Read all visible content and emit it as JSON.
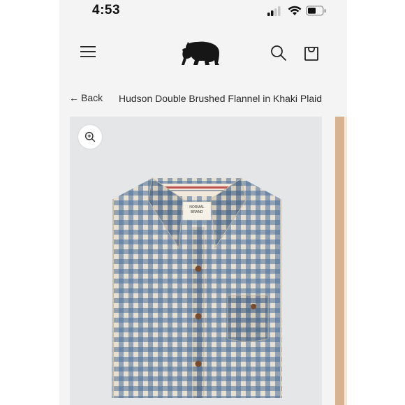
{
  "status_bar": {
    "time": "4:53",
    "icons": [
      "signal-icon",
      "wifi-icon",
      "battery-icon"
    ]
  },
  "header": {
    "icons": [
      "menu-icon",
      "bear-logo-icon",
      "search-icon",
      "shopping-bag-icon"
    ]
  },
  "breadcrumb": {
    "back_label": "Back",
    "product_title": "Hudson Double Brushed Flannel in Khaki Plaid"
  },
  "gallery": {
    "zoom_icon": "zoom-in-icon",
    "label_text": [
      "NORMAL",
      "BRAND"
    ]
  },
  "colors": {
    "page_background": "#f4f4f4",
    "gallery_background": "#e5e6e8",
    "plaid_blue": "#4c6f9a",
    "plaid_cream": "#e8dfcf",
    "button_brown": "#7a4a2c"
  }
}
